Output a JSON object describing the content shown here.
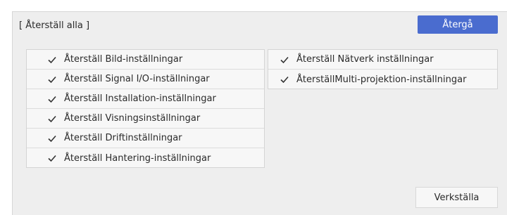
{
  "dialog": {
    "title": "[ Återställ alla ]",
    "back_label": "Återgå",
    "apply_label": "Verkställa",
    "accent_color": "#4a6ccf"
  },
  "left_items": [
    {
      "label": "Återställ Bild-inställningar",
      "checked": true
    },
    {
      "label": "Återställ Signal I/O-inställningar",
      "checked": true
    },
    {
      "label": "Återställ Installation-inställningar",
      "checked": true
    },
    {
      "label": "Återställ Visningsinställningar",
      "checked": true
    },
    {
      "label": "Återställ Driftinställningar",
      "checked": true
    },
    {
      "label": "Återställ Hantering-inställningar",
      "checked": true
    }
  ],
  "right_items": [
    {
      "label": "Återställ Nätverk inställningar",
      "checked": true
    },
    {
      "label": "ÅterställMulti-projektion-inställningar",
      "checked": true
    }
  ],
  "icons": {
    "check": "check-icon"
  }
}
